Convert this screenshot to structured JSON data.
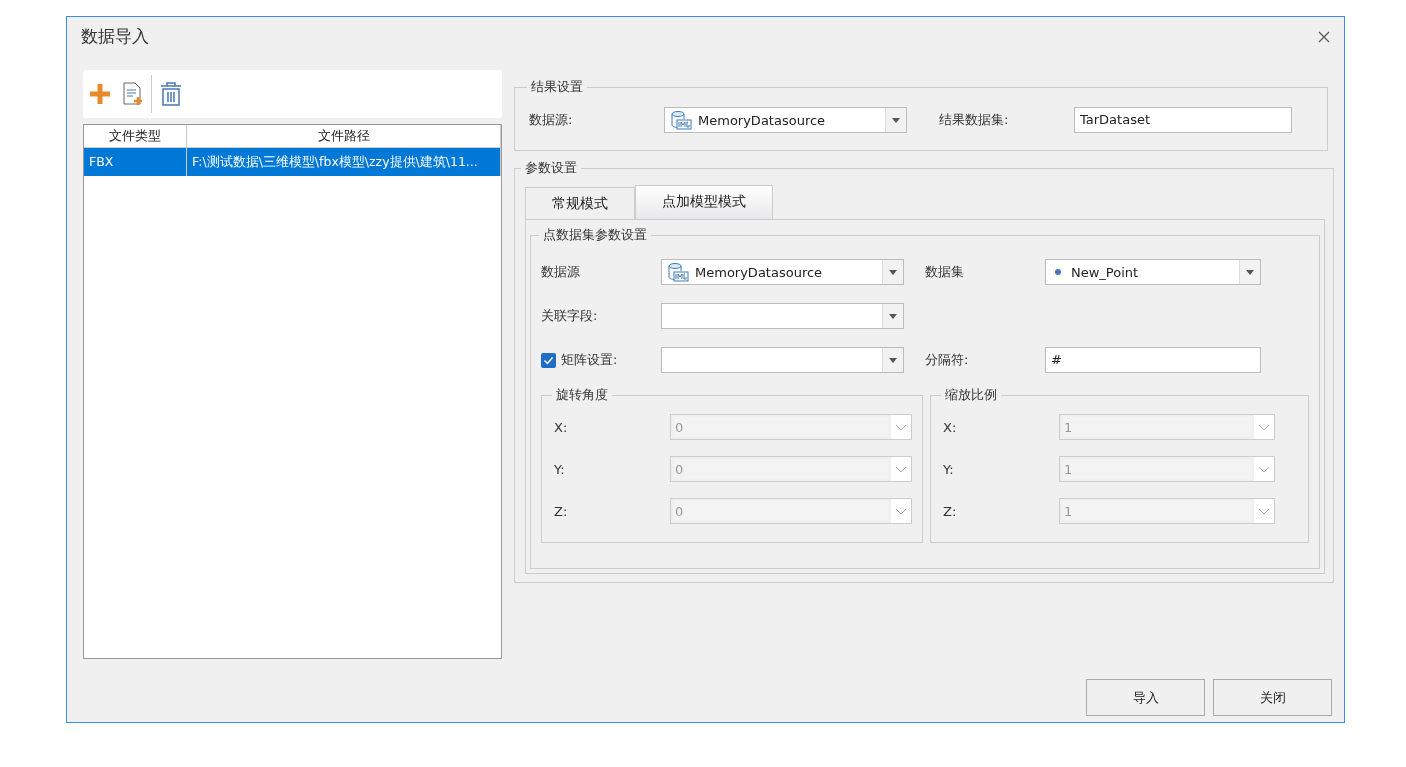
{
  "window": {
    "title": "数据导入"
  },
  "table": {
    "columns": [
      "文件类型",
      "文件路径"
    ],
    "rows": [
      {
        "cells": [
          "FBX",
          "F:\\测试数据\\三维模型\\fbx模型\\zzy提供\\建筑\\11..."
        ],
        "selected": true
      }
    ]
  },
  "result_settings": {
    "title": "结果设置",
    "fields": [
      {
        "label": "数据源:",
        "kind": "datasource_combo",
        "value": "MemoryDatasource"
      },
      {
        "label": "结果数据集:",
        "kind": "text",
        "value": "TarDataset"
      }
    ]
  },
  "param_settings": {
    "title": "参数设置",
    "tabs": [
      {
        "label": "常规模式",
        "selected": false
      },
      {
        "label": "点加模型模式",
        "selected": true
      }
    ],
    "group_title": "点数据集参数设置",
    "rows": [
      [
        {
          "label": "数据源",
          "kind": "datasource_combo",
          "value": "MemoryDatasource"
        },
        {
          "label": "数据集",
          "kind": "point_combo",
          "value": "New_Point"
        }
      ],
      [
        {
          "label": "关联字段:",
          "kind": "combo"
        }
      ],
      [
        {
          "label": "矩阵设置:",
          "kind": "checked_combo",
          "checked": true
        },
        {
          "label": "分隔符:",
          "kind": "text",
          "value": "#"
        }
      ]
    ],
    "subgroups": [
      {
        "title": "旋转角度",
        "fields": [
          {
            "label": "X:",
            "value": "0",
            "disabled": true
          },
          {
            "label": "Y:",
            "value": "0",
            "disabled": true
          },
          {
            "label": "Z:",
            "value": "0",
            "disabled": true
          }
        ]
      },
      {
        "title": "缩放比例",
        "fields": [
          {
            "label": "X:",
            "value": "1",
            "disabled": true
          },
          {
            "label": "Y:",
            "value": "1",
            "disabled": true
          },
          {
            "label": "Z:",
            "value": "1",
            "disabled": true
          }
        ]
      }
    ]
  },
  "buttons": [
    "导入",
    "关闭"
  ]
}
